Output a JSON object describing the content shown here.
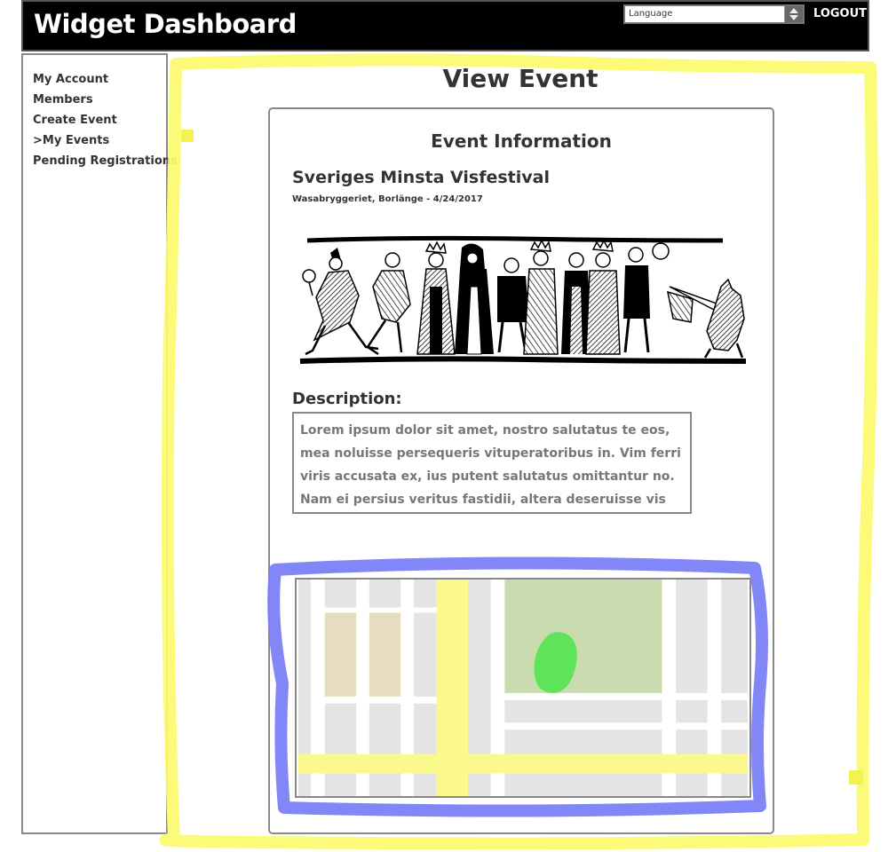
{
  "header": {
    "title": "Widget Dashboard",
    "language_placeholder": "Language",
    "logout_label": "LOGOUT"
  },
  "sidebar": {
    "items": [
      {
        "label": "My Account"
      },
      {
        "label": "Members"
      },
      {
        "label": "Create Event"
      },
      {
        "label": ">My Events"
      },
      {
        "label": "Pending Registrations"
      }
    ]
  },
  "main": {
    "page_title": "View Event",
    "panel_heading": "Event Information",
    "event_name": "Sveriges Minsta Visfestival",
    "event_meta": "Wasabryggeriet, Borlänge - 4/24/2017",
    "description_label": "Description:",
    "description_text": "Lorem ipsum dolor sit amet, nostro salutatus te eos, mea noluisse persequeris vituperatoribus in. Vim ferri viris accusata ex, ius putent salutatus omittantur no. Nam ei persius veritus fastidii, altera deseruisse vis ut. Eum in eros"
  },
  "colors": {
    "header_bg": "#000000",
    "highlight_yellow": "#fbfb6e",
    "highlight_blue": "#7b7ff7",
    "map_park": "#c9dcb0",
    "map_marker": "#5fe35a",
    "map_block": "#e4e4e4",
    "map_block_tan": "#e6dcc0",
    "map_road_yellow": "#fbf98b"
  },
  "icons": {
    "language_stepper": "up-down-arrows-icon",
    "map_marker": "location-blob-icon"
  }
}
